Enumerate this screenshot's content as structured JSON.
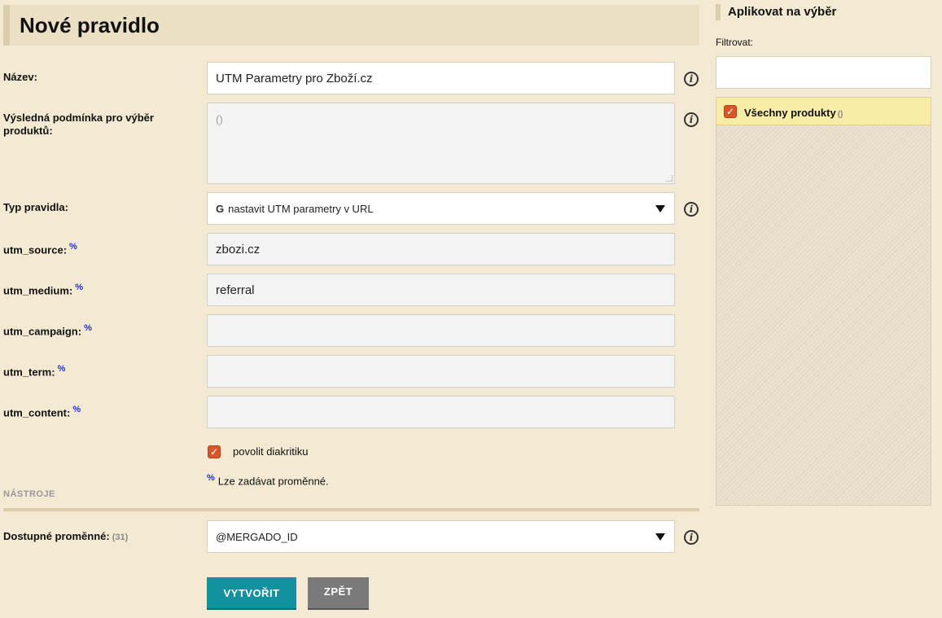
{
  "form": {
    "title": "Nové pravidlo",
    "name_label": "Název:",
    "name_value": "UTM Parametry pro Zboží.cz",
    "condition_label": "Výsledná podmínka pro výběr produktů:",
    "condition_value": "()",
    "rule_type_label": "Typ pravidla:",
    "rule_type_icon": "G",
    "rule_type_value": "nastavit UTM parametry v URL",
    "utm_source_label": "utm_source:",
    "utm_source_value": "zbozi.cz",
    "utm_medium_label": "utm_medium:",
    "utm_medium_value": "referral",
    "utm_campaign_label": "utm_campaign:",
    "utm_campaign_value": "",
    "utm_term_label": "utm_term:",
    "utm_term_value": "",
    "utm_content_label": "utm_content:",
    "utm_content_value": "",
    "percent_mark": "%",
    "diacritics_label": "povolit diakritiku",
    "diacritics_checked": true,
    "variables_note": "Lze zadávat proměnné.",
    "info_glyph": "i",
    "check_glyph": "✓"
  },
  "tools": {
    "section_label": "NÁSTROJE",
    "variables_label": "Dostupné proměnné:",
    "variables_count": "(31)",
    "variables_selected": "@MERGADO_ID"
  },
  "actions": {
    "create_label": "VYTVOŘIT",
    "back_label": "ZPĚT"
  },
  "sidebar": {
    "title": "Aplikovat na výběr",
    "filter_label": "Filtrovat:",
    "filter_value": "",
    "items": [
      {
        "label": "Všechny produkty",
        "suffix": "()",
        "checked": true
      }
    ]
  },
  "colors": {
    "background": "#f4ead3",
    "accent_teal": "#12919e",
    "checkbox_orange": "#d9552b",
    "selected_item": "#f8eca6",
    "percent_blue": "#1a2fd1"
  }
}
